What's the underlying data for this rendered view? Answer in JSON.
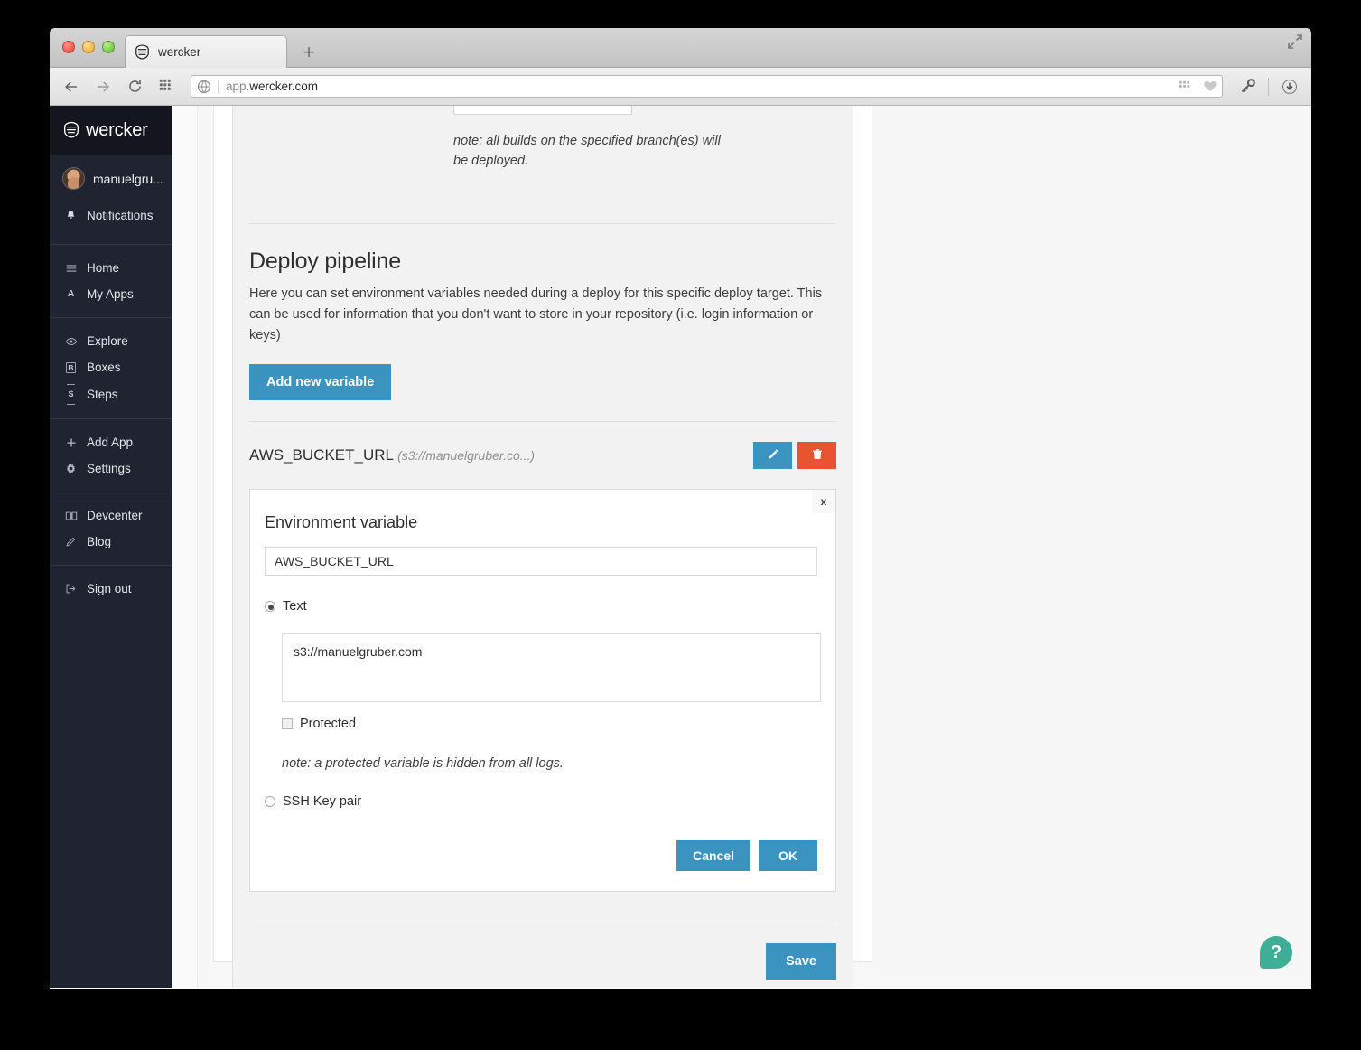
{
  "browser": {
    "tab_title": "wercker",
    "url_prefix": "app.",
    "url_main": "wercker.com",
    "new_tab_label": "+",
    "back_icon": "back-arrow-icon",
    "forward_icon": "forward-arrow-icon",
    "reload_icon": "reload-icon",
    "apps_icon": "apps-grid-icon",
    "globe_icon": "globe-icon",
    "bookmarks_grid_icon": "bookmark-grid-icon",
    "heart_icon": "heart-icon",
    "key_icon": "key-icon",
    "download_icon": "download-icon",
    "fullscreen_icon": "fullscreen-icon"
  },
  "sidebar": {
    "brand": "wercker",
    "user": "manuelgru...",
    "groups": [
      {
        "items": [
          {
            "label": "Notifications",
            "icon": "bell-icon"
          }
        ]
      },
      {
        "items": [
          {
            "label": "Home",
            "icon": "hamburger-icon"
          },
          {
            "label": "My Apps",
            "icon": "letter-a-icon"
          }
        ]
      },
      {
        "items": [
          {
            "label": "Explore",
            "icon": "eye-icon"
          },
          {
            "label": "Boxes",
            "icon": "letter-b-boxed-icon"
          },
          {
            "label": "Steps",
            "icon": "letter-s-icon"
          }
        ]
      },
      {
        "items": [
          {
            "label": "Add App",
            "icon": "plus-icon"
          },
          {
            "label": "Settings",
            "icon": "gear-icon"
          }
        ]
      },
      {
        "items": [
          {
            "label": "Devcenter",
            "icon": "book-icon"
          },
          {
            "label": "Blog",
            "icon": "pencil-icon"
          }
        ]
      },
      {
        "items": [
          {
            "label": "Sign out",
            "icon": "sign-out-icon"
          }
        ]
      }
    ]
  },
  "main": {
    "branch_note": "note: all builds on the specified branch(es) will be deployed.",
    "section_title": "Deploy pipeline",
    "section_desc": "Here you can set environment variables needed during a deploy for this specific deploy target. This can be used for information that you don't want to store in your repository (i.e. login information or keys)",
    "add_variable_label": "Add new variable",
    "variable": {
      "name": "AWS_BUCKET_URL",
      "preview": "(s3://manuelgruber.co...)",
      "edit_icon": "pencil-icon",
      "delete_icon": "trash-icon"
    },
    "editor": {
      "close_label": "x",
      "title": "Environment variable",
      "name_value": "AWS_BUCKET_URL",
      "type_text_label": "Text",
      "type_text_selected": true,
      "value_text": "s3://manuelgruber.com",
      "protected_label": "Protected",
      "protected_checked": false,
      "protected_note": "note: a protected variable is hidden from all logs.",
      "type_ssh_label": "SSH Key pair",
      "type_ssh_selected": false,
      "cancel_label": "Cancel",
      "ok_label": "OK"
    },
    "save_label": "Save"
  },
  "help": {
    "glyph": "?"
  },
  "colors": {
    "accent_blue": "#3b93c0",
    "danger_red": "#e8542f",
    "sidebar_bg": "#1f2430",
    "sidebar_logo_bg": "#13161f",
    "help_teal": "#3fae97",
    "panel_bg": "#f2f2f2"
  }
}
